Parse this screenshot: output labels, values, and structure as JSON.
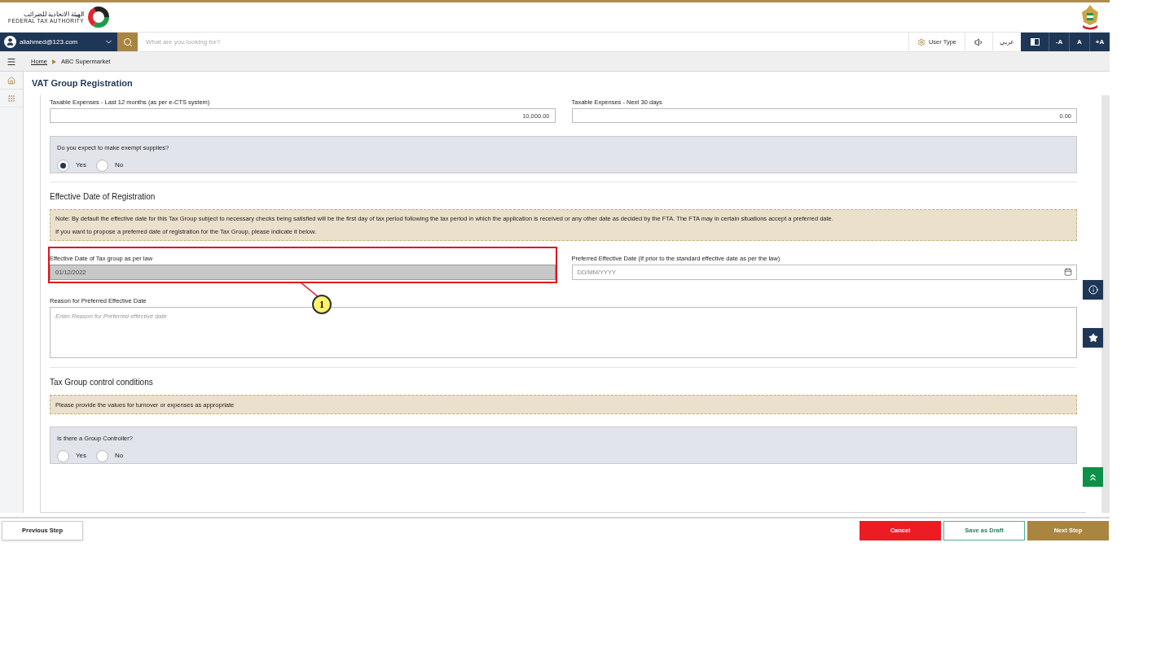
{
  "header": {
    "logo_arabic": "الهيئة الاتحادية للضرائب",
    "logo_english": "FEDERAL TAX AUTHORITY"
  },
  "nav": {
    "user": "aliahmed@123.com",
    "search_placeholder": "What are you looking for?",
    "user_type": "User Type",
    "language": "عربي",
    "font_buttons": [
      "-A",
      "A",
      "+A"
    ]
  },
  "breadcrumb": [
    {
      "label": "Home",
      "link": true
    },
    {
      "label": "ABC Supermarket",
      "link": false
    }
  ],
  "page_title": "VAT Group Registration",
  "expenses": [
    {
      "label": "Taxable Expenses - Last 12 months (as per e-CTS system)",
      "value": "10,000.00"
    },
    {
      "label": "Taxable Expenses - Next 30 days",
      "value": "0.00"
    }
  ],
  "exempt_supplies": {
    "question": "Do you expect to make exempt supplies?",
    "options": [
      {
        "label": "Yes",
        "selected": true
      },
      {
        "label": "No",
        "selected": false
      }
    ]
  },
  "effective_date_section": {
    "heading": "Effective Date of Registration",
    "note_lines": [
      "Note: By default the effective date for this Tax Group subject to necessary checks being satisfied will be the first day of tax period following the tax period in which the application is received or any other date as decided by the FTA. The FTA may in certain situations accept a preferred date.",
      "If you want to propose a preferred date of registration for the Tax Group, please indicate it below."
    ],
    "law_date": {
      "label": "Effective Date of Tax group as per law",
      "value": "01/12/2022",
      "disabled": true
    },
    "preferred_date": {
      "label": "Preferred Effective Date (If prior to the standard effective date as per the law)",
      "placeholder": "DD/MM/YYYY"
    },
    "reason": {
      "label": "Reason for Preferred Effective Date",
      "placeholder": "Enter Reason for Preferred effective date"
    }
  },
  "callout": {
    "number": "1"
  },
  "control_section": {
    "heading": "Tax Group control conditions",
    "note": "Please provide the values for turnover or expenses as appropriate",
    "group_controller": {
      "question": "Is there a Group Controller?",
      "options": [
        {
          "label": "Yes",
          "selected": false
        },
        {
          "label": "No",
          "selected": false
        }
      ]
    }
  },
  "footer": {
    "previous": "Previous Step",
    "cancel": "Cancel",
    "draft": "Save as Draft",
    "next": "Next Step"
  }
}
